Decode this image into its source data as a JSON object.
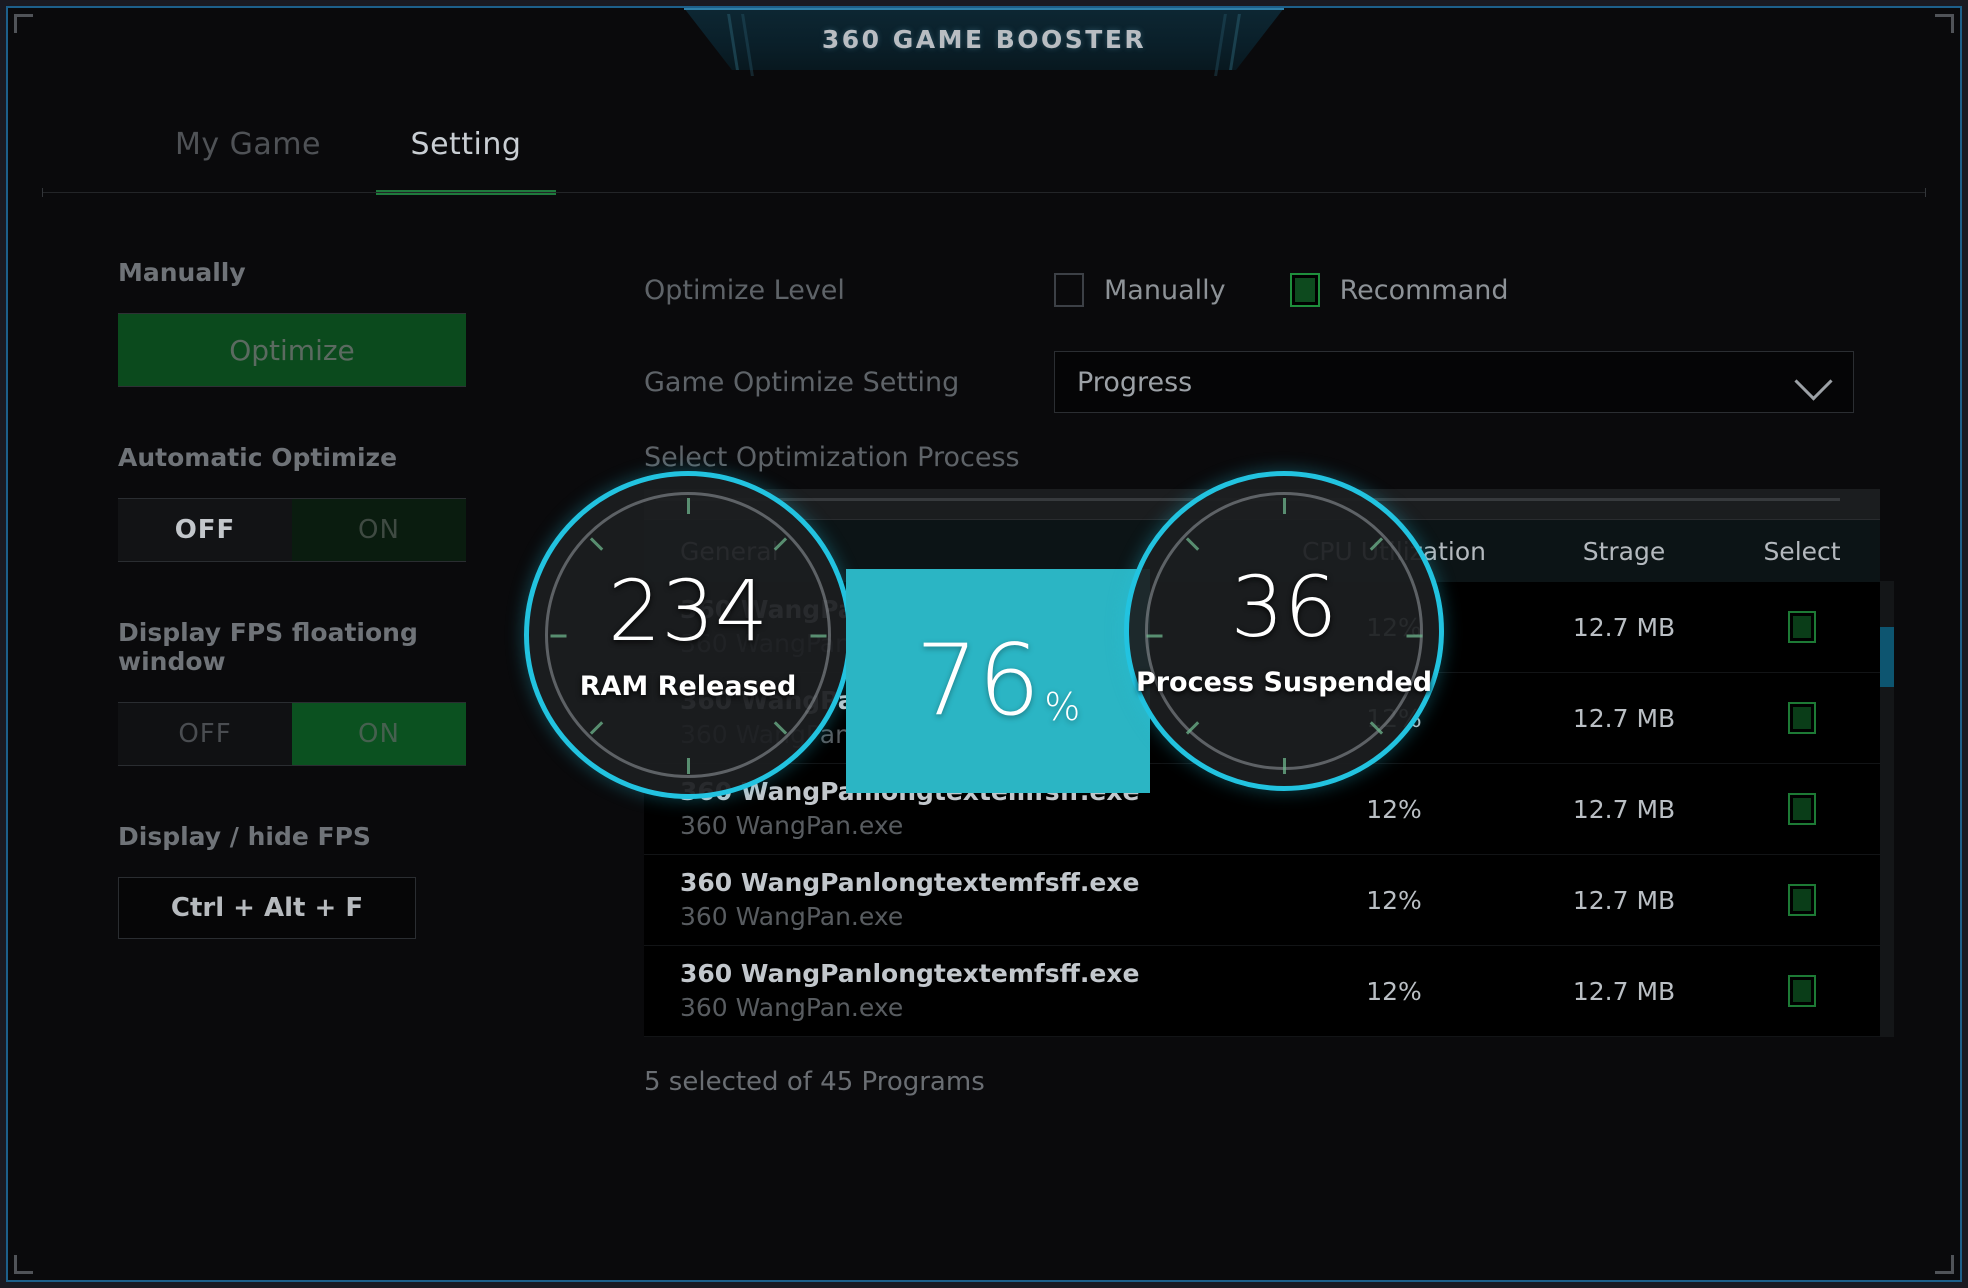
{
  "window": {
    "title": "360 GAME BOOSTER"
  },
  "tabs": [
    {
      "label": "My Game",
      "active": false
    },
    {
      "label": "Setting",
      "active": true
    }
  ],
  "left_panel": {
    "manually_label": "Manually",
    "optimize_button": "Optimize",
    "automatic_optimize_label": "Automatic Optimize",
    "automatic_optimize_off": "OFF",
    "automatic_optimize_on": "ON",
    "fps_window_label": "Display FPS floationg window",
    "fps_window_off": "OFF",
    "fps_window_on": "ON",
    "display_hide_fps_label": "Display / hide FPS",
    "hotkey": "Ctrl + Alt + F"
  },
  "right_panel": {
    "optimize_level_label": "Optimize Level",
    "optimize_level_options": [
      {
        "label": "Manually",
        "checked": false
      },
      {
        "label": "Recommand",
        "checked": true
      }
    ],
    "game_optimize_setting_label": "Game Optimize Setting",
    "game_optimize_setting_value": "Progress",
    "select_process_label": "Select Optimization Process",
    "table_headers": {
      "general": "General",
      "cpu": "CPU Utilization",
      "storage": "Strage",
      "select": "Select"
    },
    "rows": [
      {
        "primary": "360 WangPanlongtextemfsff.exe",
        "secondary": "360 WangPan.exe",
        "cpu": "12%",
        "storage": "12.7 MB",
        "selected": true
      },
      {
        "primary": "360 WangPanlongtextemfsff.exe",
        "secondary": "360 WangPan.exe",
        "cpu": "12%",
        "storage": "12.7 MB",
        "selected": true
      },
      {
        "primary": "360 WangPanlongtextemfsff.exe",
        "secondary": "360 WangPan.exe",
        "cpu": "12%",
        "storage": "12.7 MB",
        "selected": true
      },
      {
        "primary": "360 WangPanlongtextemfsff.exe",
        "secondary": "360 WangPan.exe",
        "cpu": "12%",
        "storage": "12.7 MB",
        "selected": true
      },
      {
        "primary": "360 WangPanlongtextemfsff.exe",
        "secondary": "360 WangPan.exe",
        "cpu": "12%",
        "storage": "12.7 MB",
        "selected": true
      }
    ],
    "selected_count": "5 selected of 45 Programs"
  },
  "overlay": {
    "ram_gauge": {
      "value": "234",
      "caption": "RAM Released"
    },
    "center": {
      "value": "76",
      "unit": "%"
    },
    "process_gauge": {
      "value": "36",
      "caption": "Process Suspended"
    }
  },
  "colors": {
    "accent_cyan": "#2bb5c4",
    "gauge_ring": "#22c3e0",
    "green": "#1e8f3c",
    "frame_blue": "#1d5f8a"
  }
}
